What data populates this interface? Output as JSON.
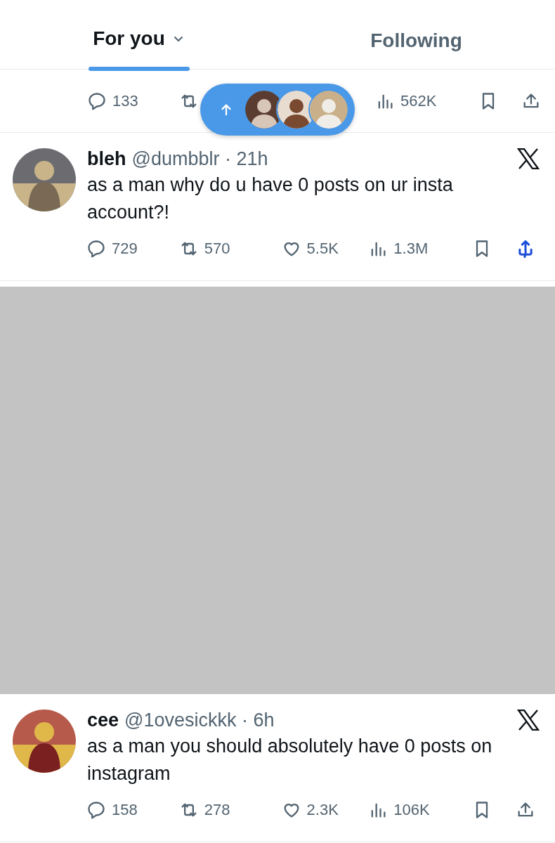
{
  "tabs": [
    {
      "label": "For you",
      "selected": true,
      "dropdown": true
    },
    {
      "label": "Following",
      "selected": false,
      "dropdown": false
    }
  ],
  "partial_post": {
    "actions": [
      {
        "kind": "reply",
        "count": "133"
      },
      {
        "kind": "repost"
      },
      {
        "kind": "views",
        "count": "562K"
      },
      {
        "kind": "bookmark"
      },
      {
        "kind": "share"
      }
    ]
  },
  "posts": [
    {
      "name": "bleh",
      "meta": "@dumbblr · 21h",
      "text": "as a man why do u have 0 posts on ur insta account?!",
      "scribbled": true,
      "actions": [
        {
          "kind": "reply",
          "count": "729"
        },
        {
          "kind": "repost",
          "count": "570"
        },
        {
          "kind": "like",
          "count": "5.5K"
        },
        {
          "kind": "views",
          "count": "1.3M"
        },
        {
          "kind": "bookmark"
        },
        {
          "kind": "share"
        }
      ]
    },
    {
      "kind": "media_placeholder"
    },
    {
      "name": "cee",
      "meta": "@1ovesickkk · 6h",
      "text": "as a man you should absolutely have 0 posts on instagram",
      "scribbled": false,
      "actions": [
        {
          "kind": "reply",
          "count": "158"
        },
        {
          "kind": "repost",
          "count": "278"
        },
        {
          "kind": "like",
          "count": "2.3K"
        },
        {
          "kind": "views",
          "count": "106K"
        },
        {
          "kind": "bookmark"
        },
        {
          "kind": "share"
        }
      ]
    }
  ]
}
